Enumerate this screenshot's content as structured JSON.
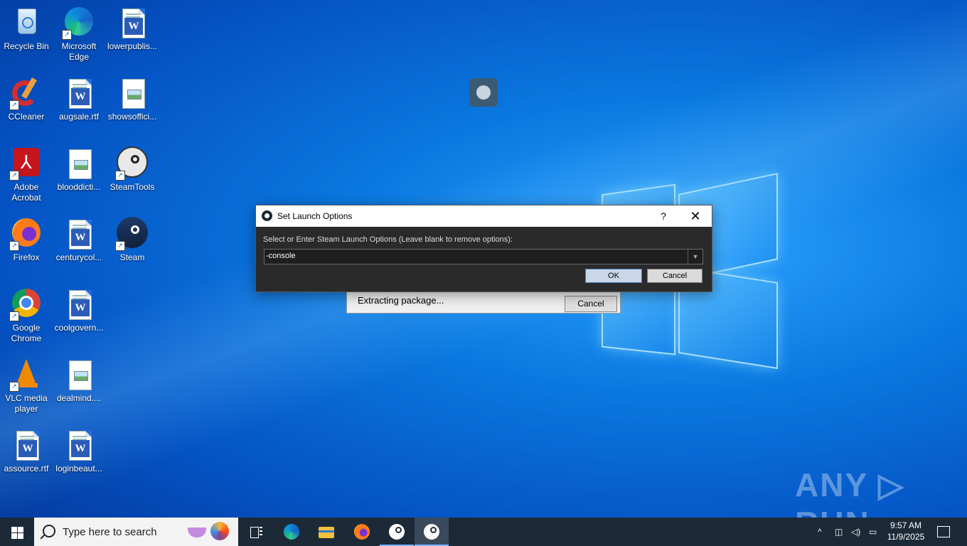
{
  "desktop": {
    "icons": [
      {
        "id": "recycle-bin",
        "label": "Recycle Bin"
      },
      {
        "id": "microsoft-edge",
        "label": "Microsoft Edge"
      },
      {
        "id": "lowerpublis",
        "label": "lowerpublis..."
      },
      {
        "id": "ccleaner",
        "label": "CCleaner"
      },
      {
        "id": "augsale",
        "label": "augsale.rtf"
      },
      {
        "id": "showsoffici",
        "label": "showsoffici..."
      },
      {
        "id": "adobe-acrobat",
        "label": "Adobe Acrobat"
      },
      {
        "id": "blooddicti",
        "label": "blooddicti..."
      },
      {
        "id": "steamtools",
        "label": "SteamTools"
      },
      {
        "id": "firefox",
        "label": "Firefox"
      },
      {
        "id": "centurycol",
        "label": "centurycol..."
      },
      {
        "id": "steam",
        "label": "Steam"
      },
      {
        "id": "google-chrome",
        "label": "Google Chrome"
      },
      {
        "id": "coolgovern",
        "label": "coolgovern..."
      },
      {
        "id": "vlc",
        "label": "VLC media player"
      },
      {
        "id": "dealmind",
        "label": "dealmind...."
      },
      {
        "id": "assource",
        "label": "assource.rtf"
      },
      {
        "id": "loginbeaut",
        "label": "loginbeaut..."
      }
    ]
  },
  "extract_window": {
    "status_text": "Extracting package...",
    "cancel_label": "Cancel"
  },
  "launch_dialog": {
    "title": "Set Launch Options",
    "help_label": "?",
    "close_label": "✕",
    "prompt": "Select or Enter Steam Launch Options (Leave blank to remove options):",
    "input_value": "-console",
    "ok_label": "OK",
    "cancel_label": "Cancel"
  },
  "watermark": "ANY ▷ RUN",
  "taskbar": {
    "search_placeholder": "Type here to search",
    "apps": [
      "task-view",
      "microsoft-edge",
      "file-explorer",
      "firefox",
      "steam",
      "steam-launch-options"
    ],
    "clock_time": "9:57 AM",
    "clock_date": "11/9/2025"
  },
  "colors": {
    "dialog_bg": "#2a2a2a",
    "taskbar_bg": "#1c2a38",
    "ok_button": "#c9d7e8"
  }
}
